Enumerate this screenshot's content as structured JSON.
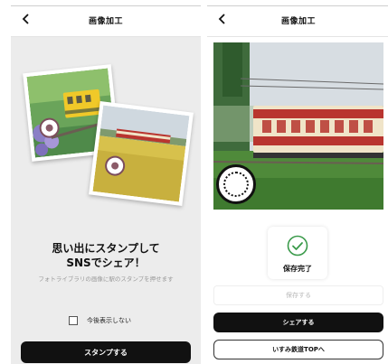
{
  "left": {
    "header": {
      "title": "画像加工"
    },
    "headline_line1": "思い出にスタンプして",
    "headline_line2": "SNSでシェア！",
    "subtext": "フォトライブラリの画像に駅のスタンプを押せます",
    "dont_show_again": "今後表示しない",
    "stamp_button": "スタンプする"
  },
  "right": {
    "header": {
      "title": "画像加工"
    },
    "saved_label": "保存完了",
    "save_button": "保存する",
    "share_button": "シェアする",
    "top_button": "いすみ鉄道TOPへ"
  },
  "colors": {
    "train_body": "#f0e4c8",
    "train_stripe": "#b9352f",
    "yellow_train": "#f0c929",
    "success_green": "#3a9a4a"
  },
  "icons": [
    "back-chevron-icon",
    "check-circle-icon",
    "stamp-icon"
  ]
}
